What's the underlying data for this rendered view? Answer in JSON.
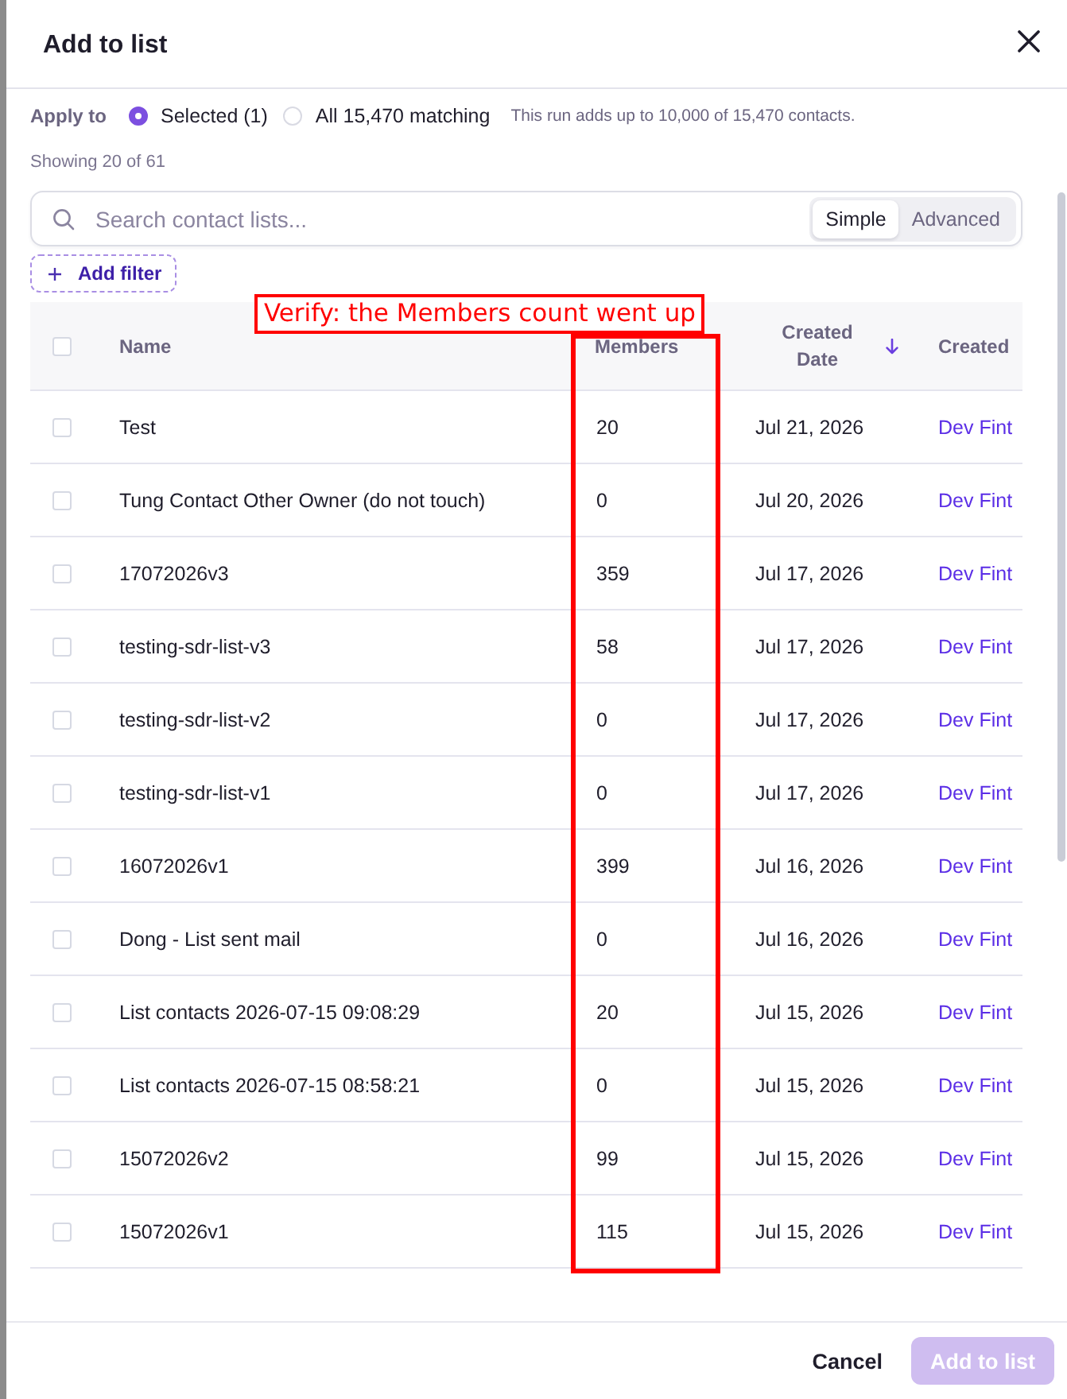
{
  "dialog": {
    "title": "Add to list"
  },
  "apply_to": {
    "label": "Apply to",
    "options": [
      {
        "label": "Selected (1)",
        "selected": true
      },
      {
        "label": "All 15,470 matching",
        "selected": false
      }
    ],
    "note": "This run adds up to 10,000 of 15,470 contacts."
  },
  "showing": "Showing 20 of 61",
  "search": {
    "placeholder": "Search contact lists...",
    "modes": [
      {
        "label": "Simple",
        "selected": true
      },
      {
        "label": "Advanced",
        "selected": false
      }
    ]
  },
  "add_filter": {
    "label": "Add filter"
  },
  "annotation": {
    "text": "Verify: the Members count went up"
  },
  "table": {
    "header_checked": false,
    "columns": [
      {
        "label": "Name",
        "sorted": false
      },
      {
        "label": "Members",
        "sorted": false
      },
      {
        "label": "Created Date",
        "sorted": true
      },
      {
        "label": "Created",
        "sorted": false
      }
    ],
    "rows": [
      {
        "checked": false,
        "name": "Test",
        "members": "20",
        "created_date": "Jul 21, 2026",
        "created": "Dev Fint"
      },
      {
        "checked": false,
        "name": "Tung Contact Other Owner (do not touch)",
        "members": "0",
        "created_date": "Jul 20, 2026",
        "created": "Dev Fint"
      },
      {
        "checked": false,
        "name": "17072026v3",
        "members": "359",
        "created_date": "Jul 17, 2026",
        "created": "Dev Fint"
      },
      {
        "checked": false,
        "name": "testing-sdr-list-v3",
        "members": "58",
        "created_date": "Jul 17, 2026",
        "created": "Dev Fint"
      },
      {
        "checked": false,
        "name": "testing-sdr-list-v2",
        "members": "0",
        "created_date": "Jul 17, 2026",
        "created": "Dev Fint"
      },
      {
        "checked": false,
        "name": "testing-sdr-list-v1",
        "members": "0",
        "created_date": "Jul 17, 2026",
        "created": "Dev Fint"
      },
      {
        "checked": false,
        "name": "16072026v1",
        "members": "399",
        "created_date": "Jul 16, 2026",
        "created": "Dev Fint"
      },
      {
        "checked": false,
        "name": "Dong - List sent mail",
        "members": "0",
        "created_date": "Jul 16, 2026",
        "created": "Dev Fint"
      },
      {
        "checked": false,
        "name": "List contacts 2026-07-15 09:08:29",
        "members": "20",
        "created_date": "Jul 15, 2026",
        "created": "Dev Fint"
      },
      {
        "checked": false,
        "name": "List contacts 2026-07-15 08:58:21",
        "members": "0",
        "created_date": "Jul 15, 2026",
        "created": "Dev Fint"
      },
      {
        "checked": false,
        "name": "15072026v2",
        "members": "99",
        "created_date": "Jul 15, 2026",
        "created": "Dev Fint"
      },
      {
        "checked": false,
        "name": "15072026v1",
        "members": "115",
        "created_date": "Jul 15, 2026",
        "created": "Dev Fint"
      }
    ]
  },
  "footer": {
    "buttons": [
      {
        "label": "Cancel",
        "kind": "secondary",
        "disabled": false
      },
      {
        "label": "Add to list",
        "kind": "primary",
        "disabled": true
      }
    ]
  }
}
